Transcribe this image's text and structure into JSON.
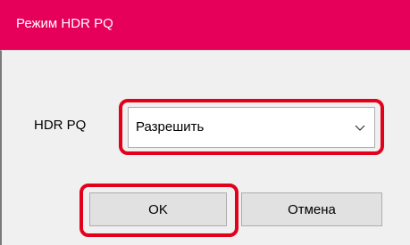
{
  "window": {
    "title": "Режим HDR PQ",
    "titlebar_color": "#e6005a"
  },
  "form": {
    "hdr_label": "HDR PQ",
    "hdr_select": {
      "value": "Разрешить",
      "icon": "chevron-down-icon"
    }
  },
  "buttons": {
    "ok_label": "OK",
    "cancel_label": "Отмена"
  },
  "annotations": {
    "highlight_color": "#e3001b",
    "highlighted": [
      "hdr-pq-select",
      "ok-button"
    ]
  }
}
